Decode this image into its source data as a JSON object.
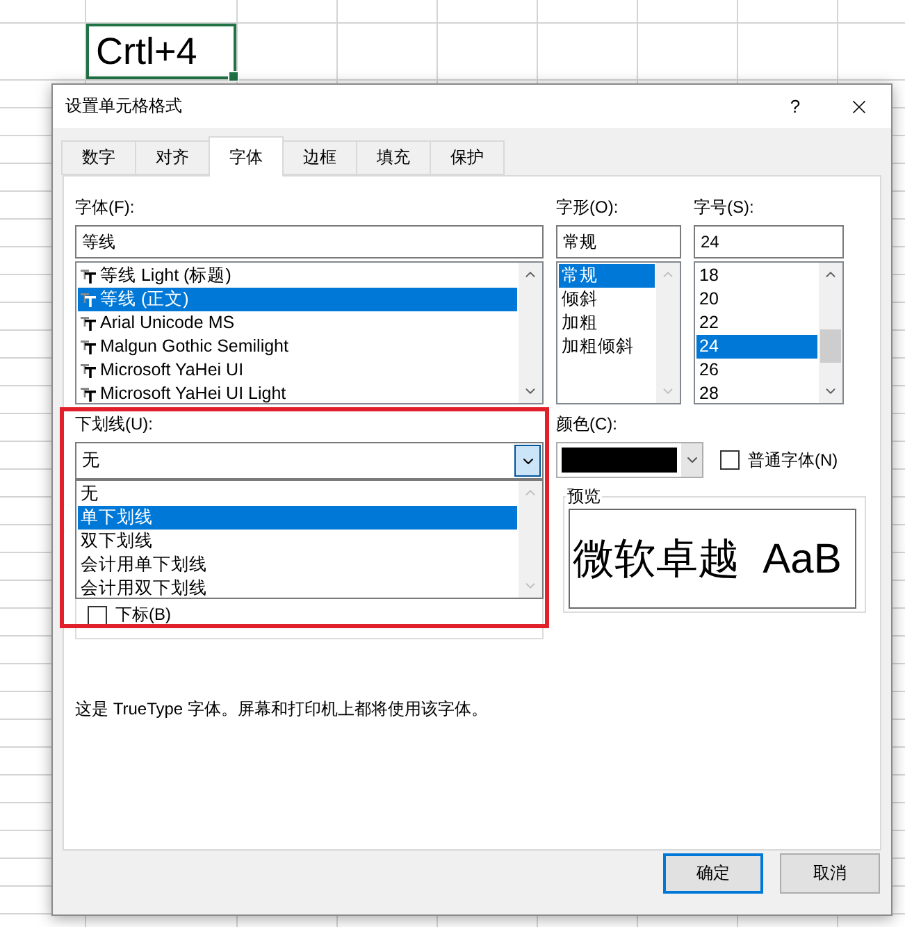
{
  "sheet": {
    "active_cell": "Crtl+4"
  },
  "dialog": {
    "title": "设置单元格格式",
    "help": "?",
    "tabs": [
      {
        "label": "数字",
        "selected": false
      },
      {
        "label": "对齐",
        "selected": false
      },
      {
        "label": "字体",
        "selected": true
      },
      {
        "label": "边框",
        "selected": false
      },
      {
        "label": "填充",
        "selected": false
      },
      {
        "label": "保护",
        "selected": false
      }
    ],
    "font": {
      "label": "字体(F):",
      "value": "等线",
      "items": [
        {
          "name": "等线 Light (标题)",
          "selected": false
        },
        {
          "name": "等线 (正文)",
          "selected": true
        },
        {
          "name": "Arial Unicode MS",
          "selected": false
        },
        {
          "name": "Malgun Gothic Semilight",
          "selected": false
        },
        {
          "name": "Microsoft YaHei UI",
          "selected": false
        },
        {
          "name": "Microsoft YaHei UI Light",
          "selected": false
        }
      ]
    },
    "style": {
      "label": "字形(O):",
      "value": "常规",
      "items": [
        {
          "name": "常规",
          "selected": true
        },
        {
          "name": "倾斜",
          "selected": false
        },
        {
          "name": "加粗",
          "selected": false
        },
        {
          "name": "加粗倾斜",
          "selected": false
        }
      ]
    },
    "size": {
      "label": "字号(S):",
      "value": "24",
      "items": [
        {
          "name": "18",
          "selected": false
        },
        {
          "name": "20",
          "selected": false
        },
        {
          "name": "22",
          "selected": false
        },
        {
          "name": "24",
          "selected": true
        },
        {
          "name": "26",
          "selected": false
        },
        {
          "name": "28",
          "selected": false
        }
      ]
    },
    "underline": {
      "label": "下划线(U):",
      "value": "无",
      "expanded": true,
      "options": [
        {
          "name": "无",
          "highlighted": false
        },
        {
          "name": "单下划线",
          "highlighted": true
        },
        {
          "name": "双下划线",
          "highlighted": false
        },
        {
          "name": "会计用单下划线",
          "highlighted": false
        },
        {
          "name": "会计用双下划线",
          "highlighted": false
        }
      ]
    },
    "color": {
      "label": "颜色(C):",
      "color": "#000000"
    },
    "normal_font": {
      "label": "普通字体(N)",
      "checked": false
    },
    "effects": [
      {
        "label": "下标(B)",
        "checked": false
      }
    ],
    "preview": {
      "label": "预览",
      "sample": "微软卓越  AaB"
    },
    "note": "这是 TrueType 字体。屏幕和打印机上都将使用该字体。",
    "buttons": [
      {
        "label": "确定",
        "default": true
      },
      {
        "label": "取消",
        "default": false
      }
    ]
  }
}
